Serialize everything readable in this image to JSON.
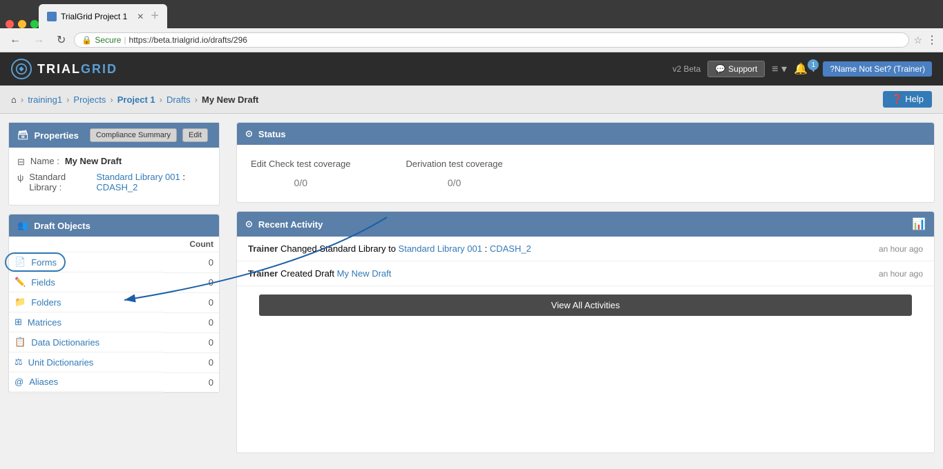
{
  "browser": {
    "tab_title": "TrialGrid Project 1",
    "url_secure": "Secure",
    "url_full": "https://beta.trialgrid.io/drafts/296",
    "url_domain": "https://beta.trialgrid.io",
    "url_path": "/drafts/296"
  },
  "topnav": {
    "logo_trial": "TRIAL",
    "logo_grid": "GRID",
    "v2_badge": "v2 Beta",
    "support_label": "Support",
    "user_label": "?Name Not Set? (Trainer)"
  },
  "breadcrumb": {
    "home": "⌂",
    "training": "training1",
    "projects": "Projects",
    "project": "Project 1",
    "drafts": "Drafts",
    "current": "My New Draft",
    "help_label": "Help"
  },
  "properties": {
    "header": "Properties",
    "compliance_summary_btn": "Compliance Summary",
    "edit_btn": "Edit",
    "name_label": "Name :",
    "name_value": "My New Draft",
    "std_library_label": "Standard Library :",
    "std_library_link1": "Standard Library 001",
    "std_library_link2": "CDASH_2"
  },
  "draft_objects": {
    "header": "Draft Objects",
    "count_label": "Count",
    "items": [
      {
        "icon": "📄",
        "label": "Forms",
        "count": "0",
        "highlighted": true
      },
      {
        "icon": "✏️",
        "label": "Fields",
        "count": "0"
      },
      {
        "icon": "📁",
        "label": "Folders",
        "count": "0"
      },
      {
        "icon": "⊞",
        "label": "Matrices",
        "count": "0"
      },
      {
        "icon": "📋",
        "label": "Data Dictionaries",
        "count": "0"
      },
      {
        "icon": "⚖",
        "label": "Unit Dictionaries",
        "count": "0"
      },
      {
        "icon": "@",
        "label": "Aliases",
        "count": "0"
      }
    ]
  },
  "status": {
    "header": "Status",
    "edit_check_label": "Edit Check test coverage",
    "derivation_label": "Derivation test coverage",
    "edit_check_value": "0/0",
    "derivation_value": "0/0"
  },
  "recent_activity": {
    "header": "Recent Activity",
    "activities": [
      {
        "user": "Trainer",
        "action_text": "Changed Standard Library to ",
        "link1_text": "Standard Library 001",
        "separator": " : ",
        "link2_text": "CDASH_2",
        "time": "an hour ago"
      },
      {
        "user": "Trainer",
        "action_text": "Created Draft ",
        "link1_text": "My New Draft",
        "time": "an hour ago"
      }
    ],
    "view_all_label": "View All Activities"
  }
}
